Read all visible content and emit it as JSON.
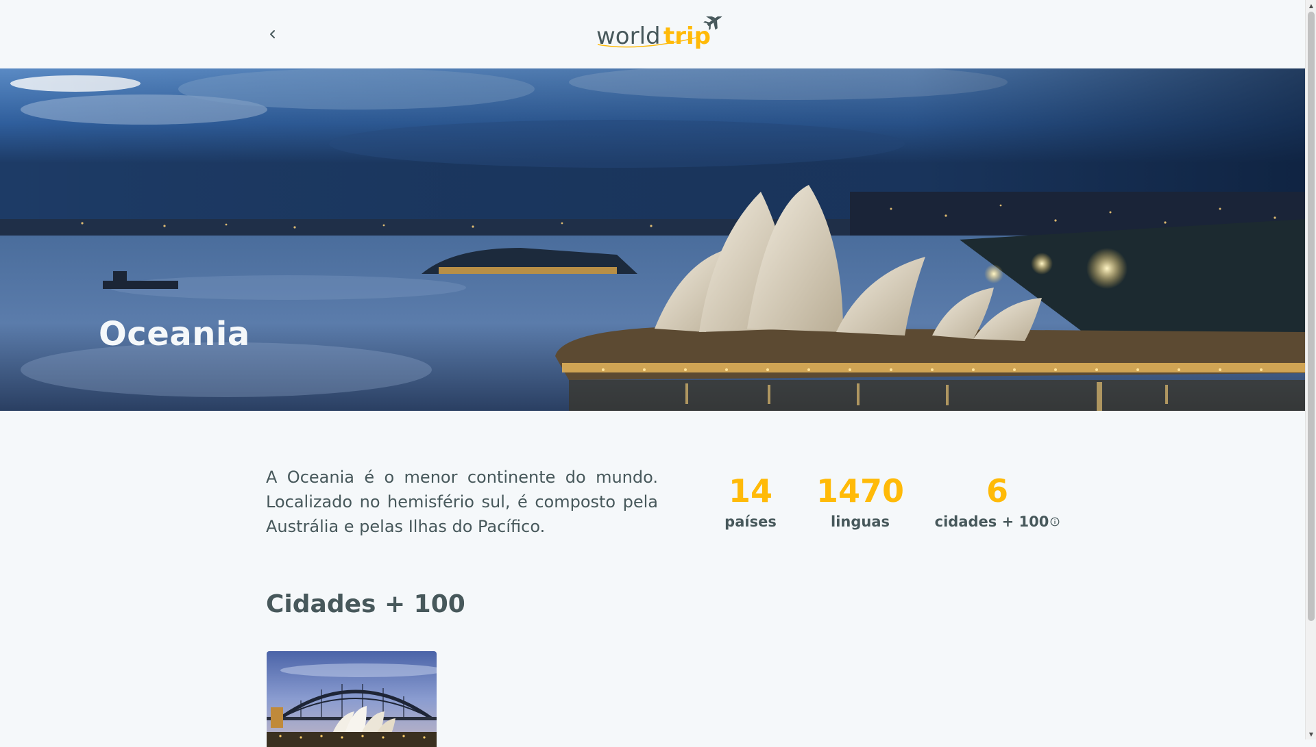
{
  "header": {
    "logo_text_world": "world",
    "logo_text_trip": "trip",
    "back_icon": "chevron-left-icon",
    "plane_icon": "airplane-icon"
  },
  "banner": {
    "title": "Oceania"
  },
  "continent": {
    "description": "A Oceania é o menor continente do mundo. Localizado no hemisfério sul, é composto pela Austrália e pelas Ilhas do Pacífico."
  },
  "stats": [
    {
      "value": "14",
      "label": "países"
    },
    {
      "value": "1470",
      "label": "linguas"
    },
    {
      "value": "6",
      "label": "cidades + 100",
      "icon": "info-icon"
    }
  ],
  "cities_section": {
    "title": "Cidades + 100"
  },
  "colors": {
    "accent": "#ffba08",
    "text": "#47585b",
    "background": "#f5f8fa"
  }
}
